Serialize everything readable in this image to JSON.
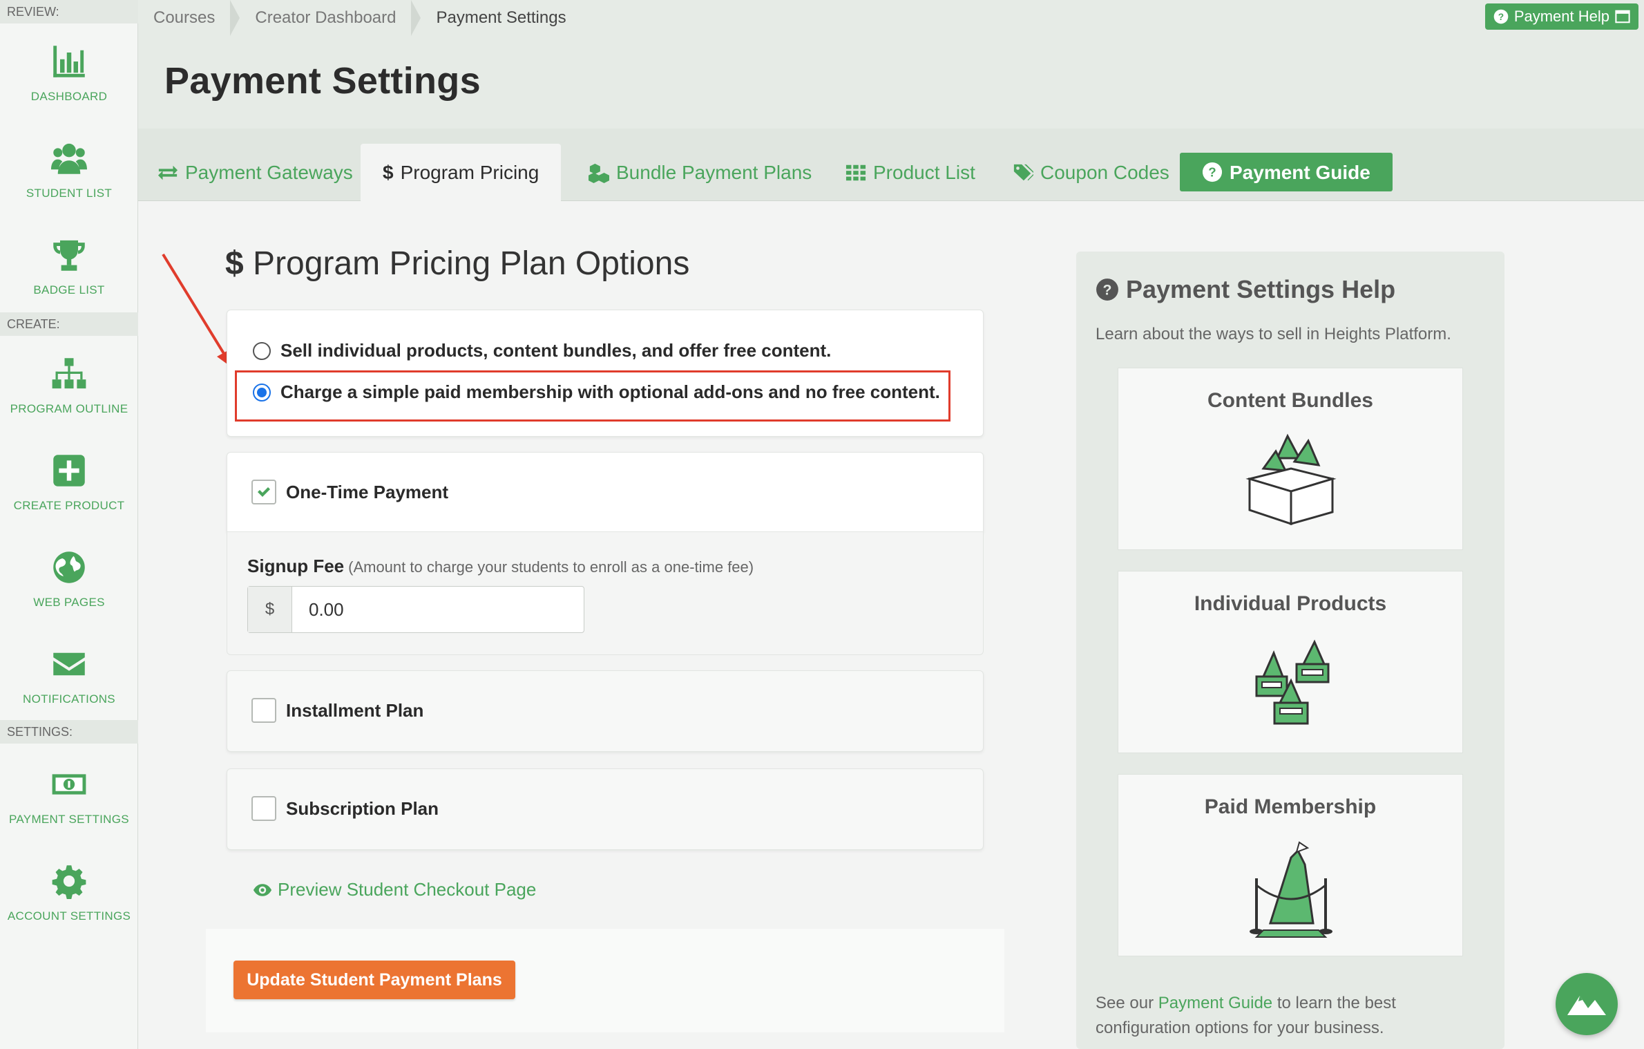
{
  "sidebar": {
    "sections": {
      "review": "REVIEW:",
      "create": "CREATE:",
      "settings": "SETTINGS:"
    },
    "items": [
      {
        "label": "DASHBOARD",
        "icon": "bar-chart-icon"
      },
      {
        "label": "STUDENT LIST",
        "icon": "users-icon"
      },
      {
        "label": "BADGE LIST",
        "icon": "trophy-icon"
      },
      {
        "label": "PROGRAM OUTLINE",
        "icon": "sitemap-icon"
      },
      {
        "label": "CREATE PRODUCT",
        "icon": "plus-square-icon"
      },
      {
        "label": "WEB PAGES",
        "icon": "globe-icon"
      },
      {
        "label": "NOTIFICATIONS",
        "icon": "envelope-icon"
      },
      {
        "label": "PAYMENT SETTINGS",
        "icon": "money-icon"
      },
      {
        "label": "ACCOUNT SETTINGS",
        "icon": "gear-icon"
      }
    ]
  },
  "breadcrumb": [
    "Courses",
    "Creator Dashboard",
    "Payment Settings"
  ],
  "help_button": "Payment Help",
  "page_title": "Payment Settings",
  "tabs": {
    "payment_gateways": "Payment Gateways",
    "program_pricing": "Program Pricing",
    "bundle_payment_plans": "Bundle Payment Plans",
    "product_list": "Product List",
    "coupon_codes": "Coupon Codes",
    "payment_guide": "Payment Guide"
  },
  "section": {
    "dollar": "$",
    "title": "Program Pricing Plan Options"
  },
  "options": {
    "option1": "Sell individual products, content bundles, and offer free content.",
    "option2": "Charge a simple paid membership with optional add-ons and no free content.",
    "selected": "option2"
  },
  "plans": {
    "one_time": {
      "label": "One-Time Payment",
      "checked": true
    },
    "installment": {
      "label": "Installment Plan",
      "checked": false
    },
    "subscription": {
      "label": "Subscription Plan",
      "checked": false
    }
  },
  "signup_fee": {
    "label": "Signup Fee",
    "hint": "(Amount to charge your students to enroll as a one-time fee)",
    "prefix": "$",
    "value": "0.00"
  },
  "preview_link": "Preview Student Checkout Page",
  "update_button": "Update Student Payment Plans",
  "help": {
    "title": "Payment Settings Help",
    "subtitle": "Learn about the ways to sell in Heights Platform.",
    "cards": [
      "Content Bundles",
      "Individual Products",
      "Paid Membership"
    ],
    "foot_prefix": "See our ",
    "foot_link": "Payment Guide",
    "foot_suffix": " to learn the best configuration options for your business."
  },
  "colors": {
    "brand_green": "#4aa55c",
    "accent_orange": "#ec7432",
    "highlight_red": "#e03c2c",
    "radio_blue": "#1a73e8"
  }
}
